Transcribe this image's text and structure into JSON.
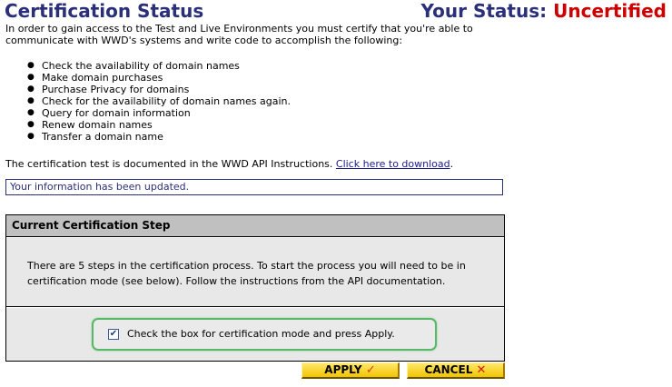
{
  "header": {
    "title": "Certification Status",
    "status_label": "Your Status:",
    "status_value": "Uncertified"
  },
  "intro": "In order to gain access to the Test and Live Environments you must certify that you're able to communicate with WWD's systems and write code to accomplish the following:",
  "requirements": [
    "Check the availability of domain names",
    "Make domain purchases",
    "Purchase Privacy for domains",
    "Check for the availability of domain names again.",
    "Query for domain information",
    "Renew domain names",
    "Transfer a domain name"
  ],
  "documentation": {
    "text": "The certification test is documented in the WWD API Instructions. ",
    "link_label": "Click here to download",
    "suffix": "."
  },
  "message": "Your information has been updated.",
  "step_panel": {
    "header": "Current Certification Step",
    "body": "There are 5 steps in the certification process. To start the process you will need to be in certification mode (see below). Follow the instructions from the API documentation.",
    "mode_checkbox_label": "Check the box for certification mode and press Apply.",
    "mode_checked": true
  },
  "buttons": {
    "apply_label": "APPLY",
    "cancel_label": "CANCEL"
  },
  "icons": {
    "bullet": "●",
    "check": "✓",
    "cross": "✕",
    "checkbox_mark": "✔"
  },
  "colors": {
    "heading": "#2a2f7a",
    "uncertified": "#cc0000",
    "button": "#f2c400",
    "highlight_border": "#58b868"
  }
}
